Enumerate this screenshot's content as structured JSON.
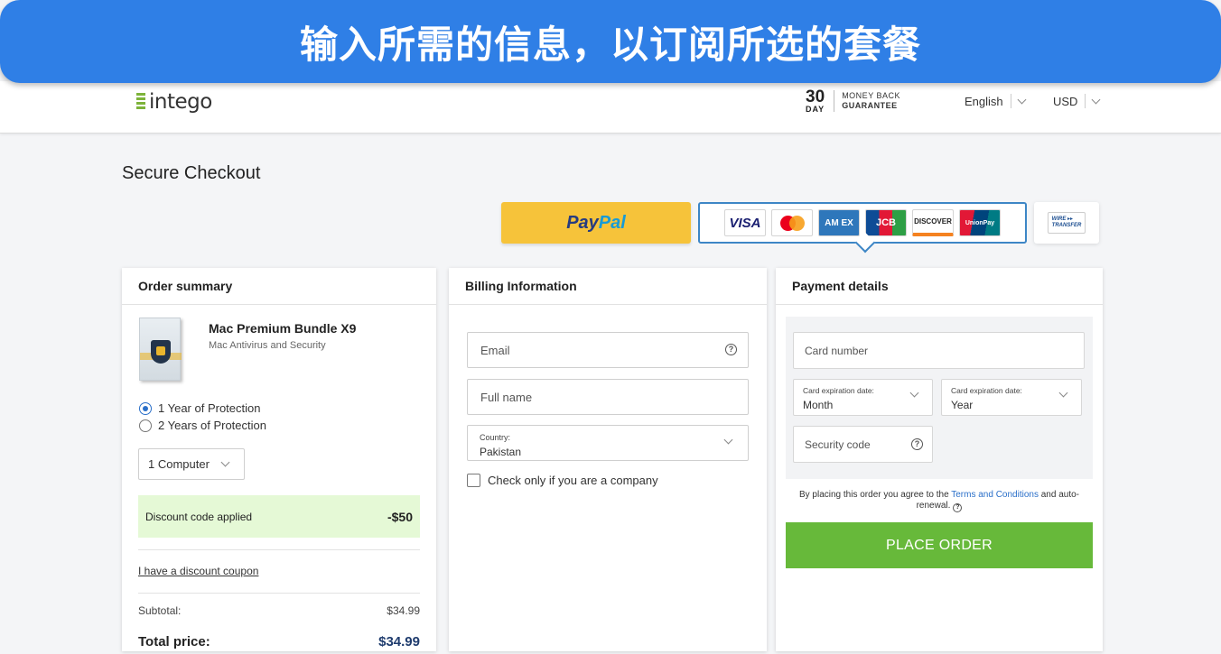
{
  "banner": {
    "text": "输入所需的信息，以订阅所选的套餐"
  },
  "header": {
    "logo_text": "intego",
    "guarantee": {
      "number": "30",
      "unit": "DAY",
      "line1": "MONEY BACK",
      "line2": "GUARANTEE"
    },
    "language": "English",
    "currency": "USD"
  },
  "page_title": "Secure Checkout",
  "payment_methods": {
    "paypal": {
      "part1": "Pay",
      "part2": "Pal"
    },
    "cards": {
      "visa": "VISA",
      "amex": "AM EX",
      "jcb": "JCB",
      "discover": "DISCOVER",
      "unionpay": "UnionPay"
    },
    "wire": {
      "line1": "WIRE ▸▸",
      "line2": "TRANSFER"
    }
  },
  "order_summary": {
    "heading": "Order summary",
    "product_name": "Mac Premium Bundle X9",
    "product_sub": "Mac Antivirus and Security",
    "options": [
      "1 Year of Protection",
      "2 Years of Protection"
    ],
    "computers": "1 Computer",
    "discount_label": "Discount code applied",
    "discount_value": "-$50",
    "coupon_link": "I have a discount coupon",
    "subtotal_label": "Subtotal:",
    "subtotal_value": "$34.99",
    "total_label": "Total price:",
    "total_value": "$34.99"
  },
  "billing": {
    "heading": "Billing Information",
    "email_placeholder": "Email",
    "fullname_placeholder": "Full name",
    "country_label": "Country:",
    "country_value": "Pakistan",
    "company_check": "Check only if you are a company"
  },
  "payment": {
    "heading": "Payment details",
    "card_number_placeholder": "Card number",
    "exp_label": "Card expiration date:",
    "month": "Month",
    "year": "Year",
    "security_placeholder": "Security code",
    "terms_before": "By placing this order you agree to the ",
    "terms_link": "Terms and Conditions",
    "terms_after": " and auto-renewal.",
    "order_button": "PLACE ORDER"
  },
  "help_glyph": "?",
  "colors": {
    "banner": "#2f7fe6",
    "paypal": "#f6c33a",
    "accent_blue": "#3d86c6",
    "discount_bg": "#e5f9d6",
    "order_button": "#67b93a"
  }
}
